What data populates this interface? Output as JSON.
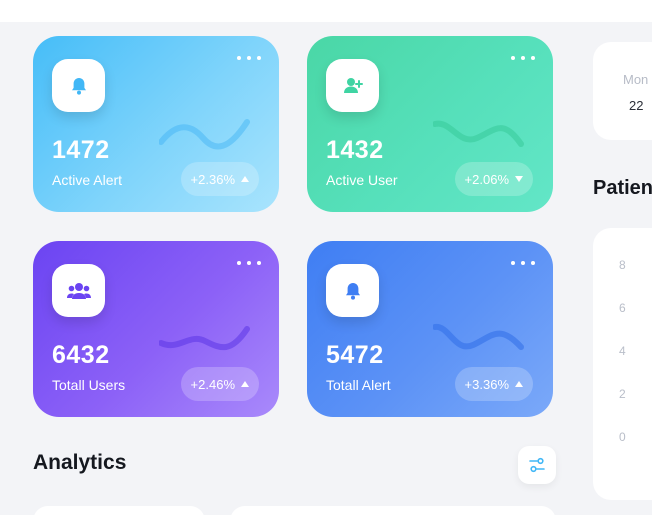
{
  "colors": {
    "alert_card": "#46bdf8",
    "user_card": "#4ad7a6",
    "users_card": "#6b44f2",
    "alert2_card": "#3f7ef3",
    "icon_alert_blue": "#41b7f6",
    "icon_user_green": "#3fd4a3",
    "icon_users_purple": "#6b44f2",
    "icon_alert2_blue": "#3f7ef3"
  },
  "cards": [
    {
      "value": "1472",
      "label": "Active Alert",
      "change": "+2.36%",
      "trend": "up",
      "icon": "bell-icon"
    },
    {
      "value": "1432",
      "label": "Active User",
      "change": "+2.06%",
      "trend": "down",
      "icon": "user-add-icon"
    },
    {
      "value": "6432",
      "label": "Totall Users",
      "change": "+2.46%",
      "trend": "up",
      "icon": "users-group-icon"
    },
    {
      "value": "5472",
      "label": "Totall Alert",
      "change": "+3.36%",
      "trend": "up",
      "icon": "bell-icon"
    }
  ],
  "analytics": {
    "title": "Analytics",
    "filter_icon": "sliders-icon"
  },
  "calendar": {
    "day": "Mon",
    "date": "22"
  },
  "patients": {
    "title": "Patien",
    "y_ticks": [
      "8",
      "6",
      "4",
      "2",
      "0"
    ]
  }
}
